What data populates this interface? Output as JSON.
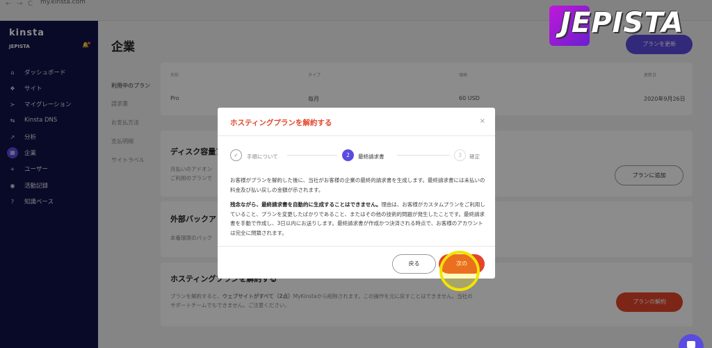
{
  "browser": {
    "url": "my.kinsta.com",
    "nav": [
      "←",
      "→",
      "C"
    ]
  },
  "sidebar": {
    "logo": "kinsta",
    "company": "JEPISTA",
    "items": [
      {
        "icon": "⌂",
        "label": "ダッシュボード"
      },
      {
        "icon": "❖",
        "label": "サイト"
      },
      {
        "icon": "≻",
        "label": "マイグレーション"
      },
      {
        "icon": "⇆",
        "label": "Kinsta DNS"
      },
      {
        "icon": "↗",
        "label": "分析"
      },
      {
        "icon": "▦",
        "label": "企業"
      },
      {
        "icon": "+",
        "label": "ユーザー"
      },
      {
        "icon": "◉",
        "label": "活動記録"
      },
      {
        "icon": "?",
        "label": "知識ベース"
      }
    ]
  },
  "page": {
    "title": "企業",
    "update_button": "プランを更新",
    "subnav": [
      "利用中のプラン",
      "請求書",
      "お支払方法",
      "支払明細",
      "サイトラベル"
    ]
  },
  "plan_table": {
    "headers": [
      "名前",
      "タイプ",
      "価格",
      "更新日"
    ],
    "row": [
      "Pro",
      "毎月",
      "60 USD",
      "2020年9月26日"
    ]
  },
  "sections": {
    "disk_title": "ディスク容量ア",
    "disk_text": "月払いのアドオン\nご利用のプランで",
    "disk_button": "プランに追加",
    "backup_title": "外部バックア",
    "backup_text": "本番環境のバック",
    "cancel_title": "ホスティングプランを解約する",
    "cancel_text_1": "プランを解約すると、",
    "cancel_text_bold": "ウェブサイトがすべて（2点）",
    "cancel_text_2": "MyKinstaから削除されます。この操作を元に戻すことはできません。当社の",
    "cancel_text_3": "サポートチームでもできません。ご注意ください。",
    "cancel_button": "プランの解約"
  },
  "modal": {
    "title": "ホスティングプランを解約する",
    "close": "×",
    "steps": [
      {
        "num": "✓",
        "label": "手順について"
      },
      {
        "num": "2",
        "label": "最終請求書"
      },
      {
        "num": "3",
        "label": "確定"
      }
    ],
    "para1": "お客様がプランを解約した後に、当社がお客様の企業の最終的請求書を生成します。最終請求書には未払いの料金及び払い戻しの金額が示されます。",
    "para2_bold": "残念ながら、最終請求書を自動的に生成することはできません。",
    "para2": "理由は、お客様がカスタムプランをご利用していること、プランを変更したばかりであること、またはその他の技術的問題が発生したことです。最終請求書を手動で作成し、3日以内にお送りします。最終請求書が作成かつ決済される時点で、お客様のアカウントは完全に閉鎖されます。",
    "back_button": "戻る",
    "next_button": "次の"
  },
  "watermark": {
    "text": "JEPISTA"
  },
  "colors": {
    "sidebar": "#12134a",
    "accent": "#5b4ce0",
    "danger": "#e3462b",
    "highlight": "#f2e400"
  }
}
